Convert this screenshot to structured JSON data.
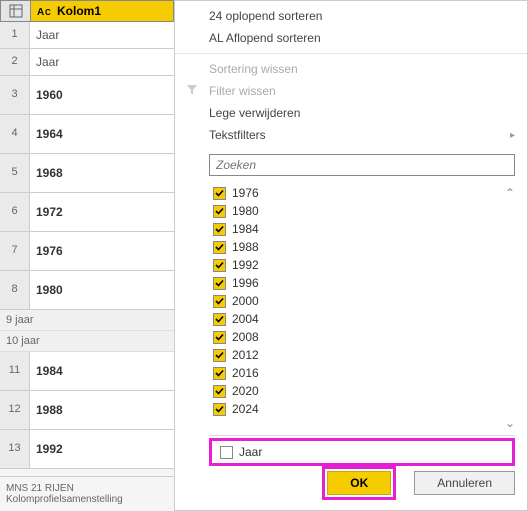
{
  "column": {
    "name": "Kolom1",
    "type_glyph": "A C"
  },
  "rows": [
    {
      "n": "1",
      "v": "Jaar"
    },
    {
      "n": "2",
      "v": "Jaar"
    },
    {
      "n": "3",
      "v": "1960"
    },
    {
      "n": "4",
      "v": "1964"
    },
    {
      "n": "5",
      "v": "1968"
    },
    {
      "n": "6",
      "v": "1972"
    },
    {
      "n": "7",
      "v": "1976"
    },
    {
      "n": "8",
      "v": "1980"
    }
  ],
  "summary": {
    "line1": "9 jaar",
    "line2": "10 jaar"
  },
  "rows2": [
    {
      "n": "11",
      "v": "1984"
    },
    {
      "n": "12",
      "v": "1988"
    },
    {
      "n": "13",
      "v": "1992"
    }
  ],
  "status": "MNS 21 RIJEN Kolomprofielsamenstelling",
  "menu": {
    "sort_asc": "24 oplopend sorteren",
    "sort_desc": "AL Aflopend sorteren",
    "clear_sort": "Sortering wissen",
    "clear_filter": "Filter wissen",
    "remove_empty": "Lege verwijderen",
    "text_filters": "Tekstfilters"
  },
  "search": {
    "placeholder": "Zoeken"
  },
  "checks": {
    "items": [
      {
        "label": "1976",
        "checked": true
      },
      {
        "label": "1980",
        "checked": true
      },
      {
        "label": "1984",
        "checked": true
      },
      {
        "label": "1988",
        "checked": true
      },
      {
        "label": "1992",
        "checked": true
      },
      {
        "label": "1996",
        "checked": true
      },
      {
        "label": "2000",
        "checked": true
      },
      {
        "label": "2004",
        "checked": true
      },
      {
        "label": "2008",
        "checked": true
      },
      {
        "label": "2012",
        "checked": true
      },
      {
        "label": "2016",
        "checked": true
      },
      {
        "label": "2020",
        "checked": true
      },
      {
        "label": "2024",
        "checked": true
      }
    ],
    "unchecked_item": "Jaar"
  },
  "buttons": {
    "ok": "OK",
    "cancel": "Annuleren"
  },
  "glyphs": {
    "funnel": "⏷",
    "arrow": "▸",
    "chev_up": "⌃",
    "chev_down": "⌄"
  }
}
